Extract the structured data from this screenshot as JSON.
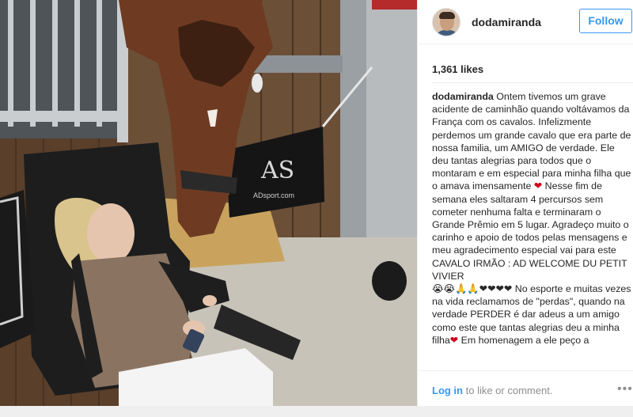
{
  "post": {
    "username": "dodamiranda",
    "follow_label": "Follow",
    "likes": "1,361 likes",
    "caption": {
      "username": "dodamiranda",
      "text_1": "Ontem tivemos um grave acidente de caminhão quando voltávamos da França com os cavalos. Infelizmente perdemos um grande cavalo que era parte de nossa familia, um AMIGO de verdade. Ele deu tantas alegrias para todos que o montaram e em especial para minha filha que o amava imensamente",
      "heart_1": "❤",
      "text_2": "Nesse fim de semana eles saltaram 4 percursos sem cometer nenhuma falta e terminaram o Grande Prêmio em 5 lugar. Agradeço muito o carinho e apoio de todos pelas mensagens e meu agradecimento especial vai para este CAVALO IRMÃO : AD WELCOME DU PETIT VIVIER",
      "emoji_line": "😭😭🙏🙏❤❤❤❤",
      "text_3": "No esporte e muitas vezes na vida reclamamos de \"perdas\", quando na verdade PERDER é dar adeus a um amigo como este que tantas alegrias deu a minha filha",
      "heart_2": "❤",
      "text_4": "Em homenagem a ele peço a"
    },
    "footer": {
      "login_link": "Log in",
      "login_rest": " to like or comment.",
      "more_icon": "more-horizontal-icon",
      "more_glyph": "•••"
    },
    "photo": {
      "sign_text": "ADsport.com",
      "sign_logo": "AS"
    }
  },
  "colors": {
    "accent": "#3897f0",
    "heart": "#d0021b",
    "text": "#262626",
    "muted": "#8e8e8e"
  }
}
